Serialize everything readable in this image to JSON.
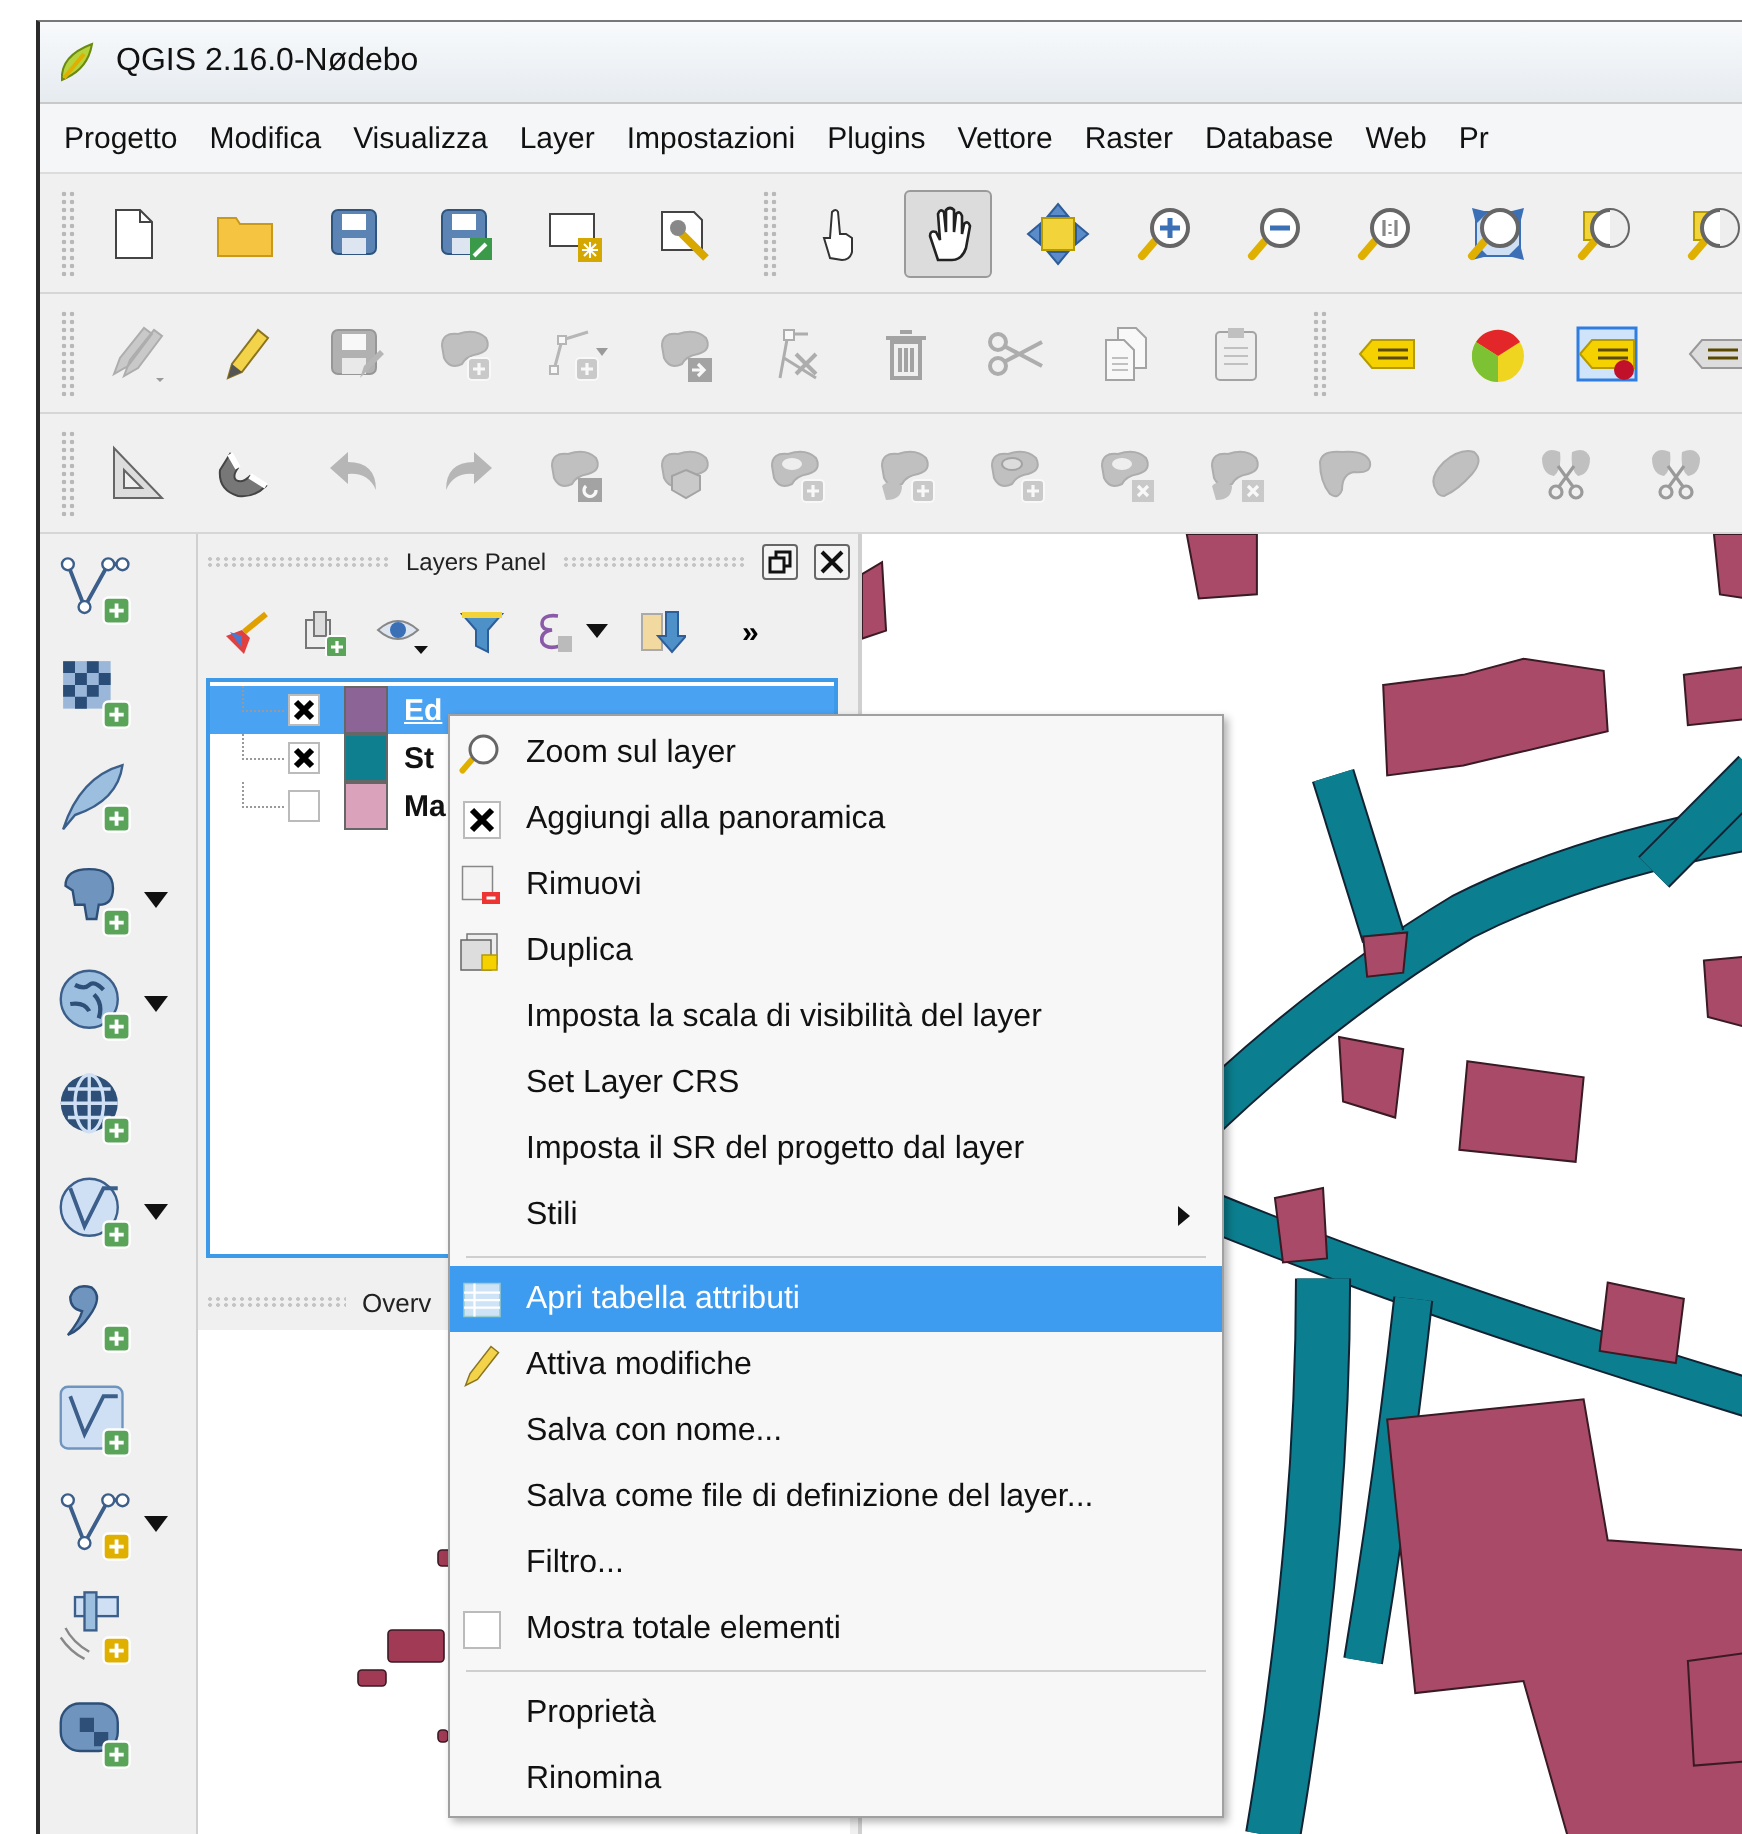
{
  "window": {
    "title": "QGIS 2.16.0-Nødebo"
  },
  "menu_bar": [
    "Progetto",
    "Modifica",
    "Visualizza",
    "Layer",
    "Impostazioni",
    "Plugins",
    "Vettore",
    "Raster",
    "Database",
    "Web",
    "Pr"
  ],
  "toolbars": [
    [
      [
        {
          "kind": "new",
          "selected": false,
          "disabled": false
        },
        {
          "kind": "open",
          "selected": false,
          "disabled": false
        },
        {
          "kind": "save",
          "selected": false,
          "disabled": false
        },
        {
          "kind": "saveas",
          "selected": false,
          "disabled": false
        },
        {
          "kind": "composer",
          "selected": false,
          "disabled": false
        },
        {
          "kind": "manager",
          "selected": false,
          "disabled": false
        }
      ],
      [
        {
          "kind": "touch",
          "selected": false,
          "disabled": false
        },
        {
          "kind": "pan",
          "selected": true,
          "disabled": false
        },
        {
          "kind": "pansel",
          "selected": false,
          "disabled": false
        },
        {
          "kind": "zoomin",
          "selected": false,
          "disabled": false
        },
        {
          "kind": "zoomout",
          "selected": false,
          "disabled": false
        },
        {
          "kind": "zoomnative",
          "selected": false,
          "disabled": false
        },
        {
          "kind": "zoomfull",
          "selected": false,
          "disabled": false
        },
        {
          "kind": "zoomlayer",
          "selected": false,
          "disabled": false
        },
        {
          "kind": "zoomlayer",
          "selected": false,
          "disabled": false
        }
      ]
    ],
    [
      [
        {
          "kind": "pencils",
          "selected": false,
          "disabled": true
        },
        {
          "kind": "pencil",
          "selected": false,
          "disabled": false
        },
        {
          "kind": "saveedits",
          "selected": false,
          "disabled": true
        },
        {
          "kind": "addfeature",
          "selected": false,
          "disabled": true
        },
        {
          "kind": "addline",
          "selected": false,
          "disabled": true
        },
        {
          "kind": "movefeature",
          "selected": false,
          "disabled": true
        },
        {
          "kind": "nodetool",
          "selected": false,
          "disabled": true
        },
        {
          "kind": "trash",
          "selected": false,
          "disabled": true
        },
        {
          "kind": "scissors",
          "selected": false,
          "disabled": true
        },
        {
          "kind": "copy",
          "selected": false,
          "disabled": true
        },
        {
          "kind": "paste",
          "selected": false,
          "disabled": true
        }
      ],
      [
        {
          "kind": "label",
          "selected": false,
          "disabled": false
        },
        {
          "kind": "diagram",
          "selected": false,
          "disabled": false
        },
        {
          "kind": "labelpin",
          "selected": false,
          "disabled": false
        },
        {
          "kind": "labelgrey",
          "selected": false,
          "disabled": false
        }
      ]
    ],
    [
      [
        {
          "kind": "setsquare",
          "selected": false,
          "disabled": false
        },
        {
          "kind": "magnet",
          "selected": false,
          "disabled": false
        },
        {
          "kind": "undo",
          "selected": false,
          "disabled": true
        },
        {
          "kind": "redo",
          "selected": false,
          "disabled": true
        },
        {
          "kind": "rotate",
          "selected": false,
          "disabled": true
        },
        {
          "kind": "simplify",
          "selected": false,
          "disabled": true
        },
        {
          "kind": "addring",
          "selected": false,
          "disabled": true
        },
        {
          "kind": "addpart",
          "selected": false,
          "disabled": true
        },
        {
          "kind": "fillring",
          "selected": false,
          "disabled": true
        },
        {
          "kind": "delring",
          "selected": false,
          "disabled": true
        },
        {
          "kind": "delpart",
          "selected": false,
          "disabled": true
        },
        {
          "kind": "reshape",
          "selected": false,
          "disabled": true
        },
        {
          "kind": "offset",
          "selected": false,
          "disabled": true
        },
        {
          "kind": "split",
          "selected": false,
          "disabled": true
        },
        {
          "kind": "split",
          "selected": false,
          "disabled": true
        }
      ]
    ]
  ],
  "layers_panel": {
    "title": "Layers Panel",
    "overflow": "»",
    "layers": [
      {
        "name": "Ed",
        "checked": true,
        "color": "#8c6596",
        "selected": true
      },
      {
        "name": "St",
        "checked": true,
        "color": "#0d7f8e",
        "selected": false
      },
      {
        "name": "Ma",
        "checked": false,
        "color": "#dba3bb",
        "selected": false
      }
    ]
  },
  "overview_panel": {
    "title": "Overv"
  },
  "context_menu": {
    "sections": [
      [
        {
          "label": "Zoom sul layer",
          "kind": "zoom",
          "selected": false
        },
        {
          "label": "Aggiungi alla panoramica",
          "kind": "check",
          "checked": true,
          "selected": false
        },
        {
          "label": "Rimuovi",
          "kind": "remove",
          "selected": false
        },
        {
          "label": "Duplica",
          "kind": "duplicate",
          "selected": false
        },
        {
          "label": "Imposta la scala di visibilità del layer",
          "kind": "plain",
          "selected": false
        },
        {
          "label": "Set Layer CRS",
          "kind": "plain",
          "selected": false
        },
        {
          "label": "Imposta il SR del progetto dal layer",
          "kind": "plain",
          "selected": false
        },
        {
          "label": "Stili",
          "kind": "submenu",
          "selected": false
        }
      ],
      [
        {
          "label": "Apri tabella attributi",
          "kind": "table",
          "selected": true
        },
        {
          "label": "Attiva modifiche",
          "kind": "pencil",
          "selected": false
        },
        {
          "label": "Salva con nome...",
          "kind": "plain",
          "selected": false
        },
        {
          "label": "Salva come file di definizione del layer...",
          "kind": "plain",
          "selected": false
        },
        {
          "label": "Filtro...",
          "kind": "plain",
          "selected": false
        },
        {
          "label": "Mostra totale elementi",
          "kind": "check",
          "checked": false,
          "selected": false
        }
      ],
      [
        {
          "label": "Proprietà",
          "kind": "plain",
          "selected": false
        },
        {
          "label": "Rinomina",
          "kind": "plain",
          "selected": false
        }
      ]
    ]
  }
}
